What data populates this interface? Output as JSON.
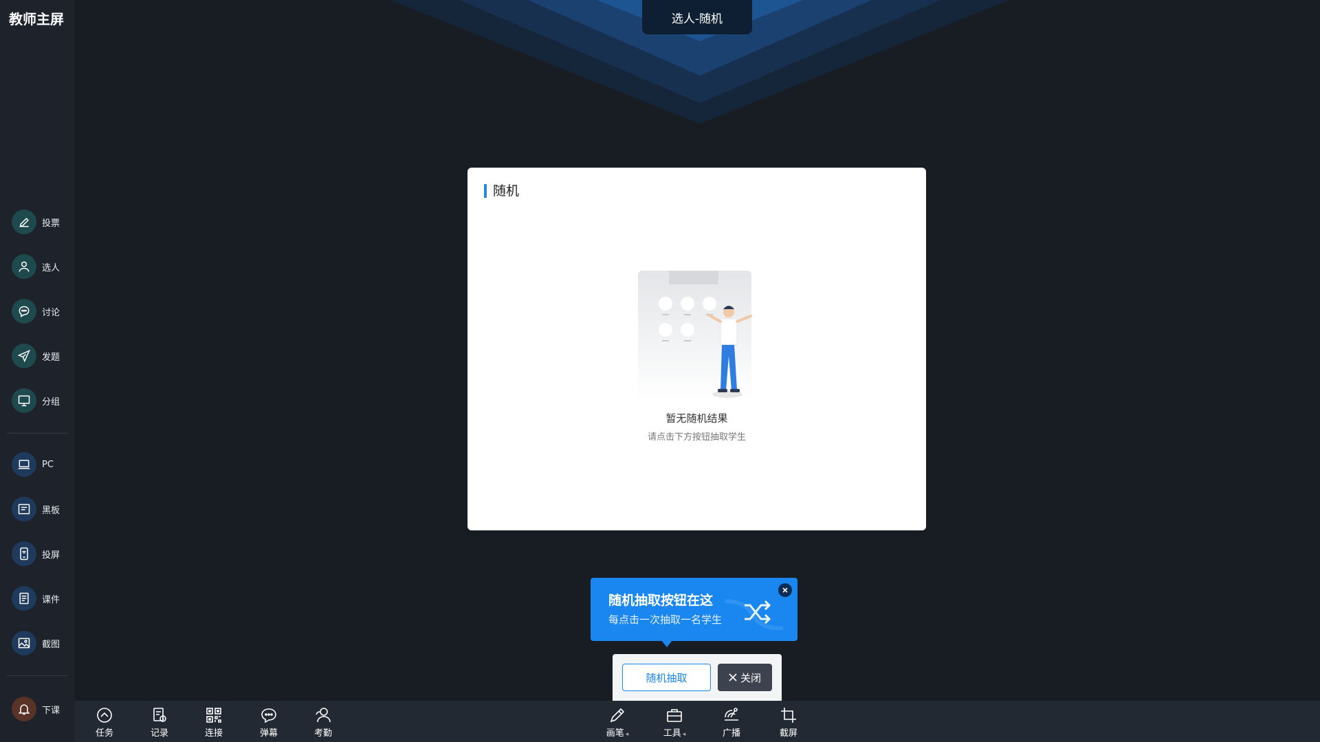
{
  "app": {
    "title": "教师主屏"
  },
  "header": {
    "tab_title": "选人-随机"
  },
  "sidebar": {
    "group1": [
      {
        "label": "投票",
        "icon": "vote-icon"
      },
      {
        "label": "选人",
        "icon": "user-icon"
      },
      {
        "label": "讨论",
        "icon": "chat-icon"
      },
      {
        "label": "发题",
        "icon": "send-icon"
      },
      {
        "label": "分组",
        "icon": "monitor-icon"
      }
    ],
    "group2": [
      {
        "label": "PC",
        "icon": "laptop-icon"
      },
      {
        "label": "黑板",
        "icon": "board-icon"
      },
      {
        "label": "投屏",
        "icon": "phone-cast-icon"
      },
      {
        "label": "课件",
        "icon": "document-icon"
      },
      {
        "label": "截图",
        "icon": "image-icon"
      }
    ],
    "end_class": {
      "label": "下课",
      "icon": "bell-icon"
    }
  },
  "card": {
    "title": "随机",
    "empty_title": "暂无随机结果",
    "empty_subtitle": "请点击下方按钮抽取学生"
  },
  "tooltip": {
    "title": "随机抽取按钮在这",
    "subtitle": "每点击一次抽取一名学生"
  },
  "actions": {
    "random_label": "随机抽取",
    "close_label": "关闭"
  },
  "bottombar": {
    "left": [
      {
        "label": "任务",
        "icon": "task-icon"
      },
      {
        "label": "记录",
        "icon": "record-icon"
      },
      {
        "label": "连接",
        "icon": "qrcode-icon"
      },
      {
        "label": "弹幕",
        "icon": "danmaku-icon"
      },
      {
        "label": "考勤",
        "icon": "attendance-icon"
      }
    ],
    "right": [
      {
        "label": "画笔",
        "icon": "pen-icon"
      },
      {
        "label": "工具",
        "icon": "toolbox-icon"
      },
      {
        "label": "广播",
        "icon": "broadcast-icon"
      },
      {
        "label": "截屏",
        "icon": "crop-icon"
      }
    ]
  },
  "colors": {
    "accent": "#1a86f0",
    "background": "#181c23",
    "sidebar": "#1d222b"
  }
}
